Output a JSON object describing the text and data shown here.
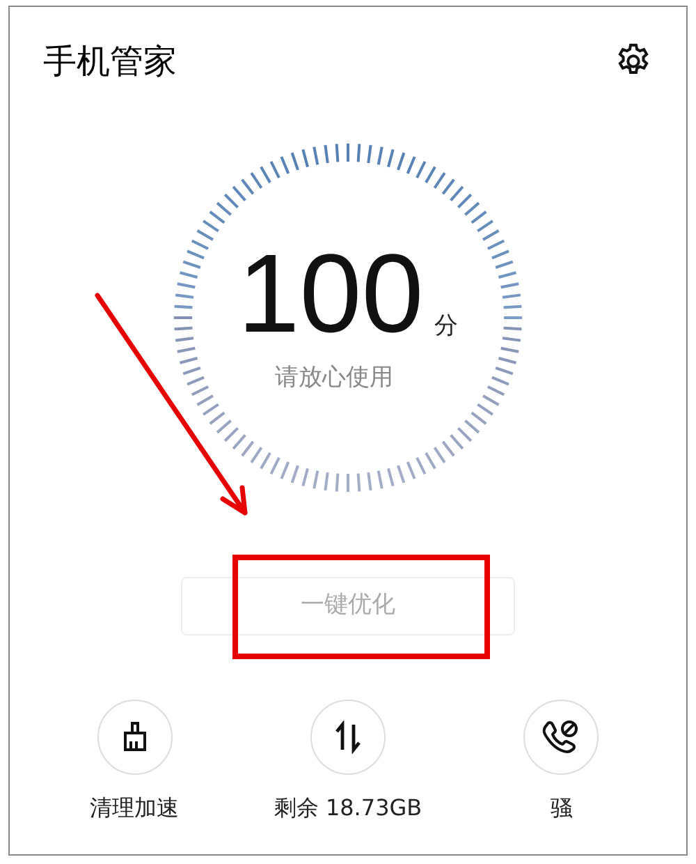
{
  "header": {
    "title": "手机管家"
  },
  "score": {
    "value": "100",
    "unit": "分",
    "caption": "请放心使用"
  },
  "optimize_button": {
    "label": "一键优化",
    "disabled": true
  },
  "tools": [
    {
      "kind": "broom",
      "label": "清理加速"
    },
    {
      "kind": "transfer",
      "label": "剩余 18.73GB"
    },
    {
      "kind": "call-block",
      "label": "骚"
    }
  ]
}
